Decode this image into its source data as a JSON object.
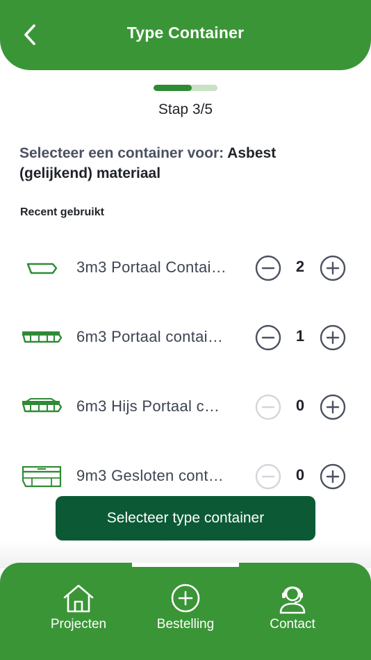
{
  "header": {
    "title": "Type Container"
  },
  "progress": {
    "current_step": 3,
    "total_steps": 5,
    "label": "Stap 3/5"
  },
  "prompt": {
    "lead": "Selecteer een container voor: ",
    "material": "Asbest (gelijkend) materiaal"
  },
  "section": {
    "recent_label": "Recent gebruikt"
  },
  "containers": [
    {
      "name": "3m3 Portaal Contai…",
      "quantity": "2",
      "icon": "portal-container-icon"
    },
    {
      "name": "6m3 Portaal contai…",
      "quantity": "1",
      "icon": "portal-container-icon"
    },
    {
      "name": "6m3 Hijs Portaal c…",
      "quantity": "0",
      "icon": "hoist-portal-container-icon"
    },
    {
      "name": "9m3 Gesloten cont…",
      "quantity": "0",
      "icon": "closed-container-icon"
    }
  ],
  "cta": {
    "label": "Selecteer type container"
  },
  "nav": {
    "items": [
      {
        "label": "Projecten",
        "icon": "home-icon"
      },
      {
        "label": "Bestelling",
        "icon": "plus-circle-icon"
      },
      {
        "label": "Contact",
        "icon": "support-agent-icon"
      }
    ]
  },
  "colors": {
    "brand_green": "#3a9537",
    "cta_dark_green": "#0b5a35",
    "progress_fill": "#2f8a35",
    "progress_track": "#c8e2c4",
    "stepper_active": "#4a5160",
    "stepper_disabled": "#d3d6da"
  }
}
